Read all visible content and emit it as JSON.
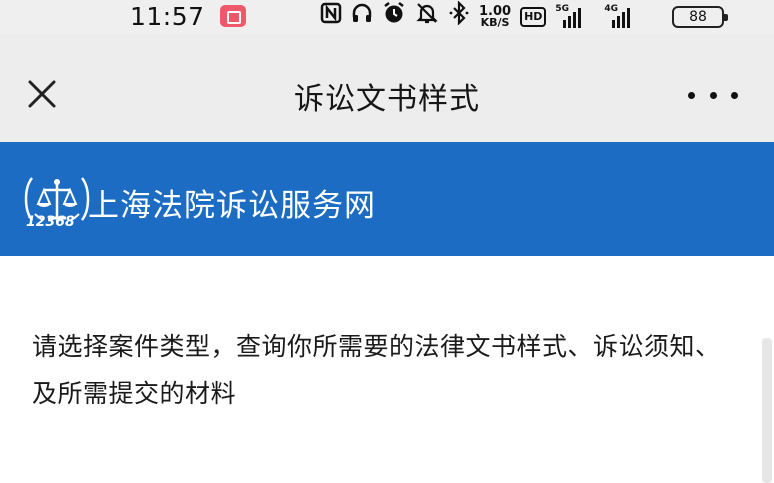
{
  "status_bar": {
    "time": "11:57",
    "net_speed": "1.00",
    "net_unit": "KB/S",
    "hd_badge": "HD",
    "signal1_label": "5G",
    "signal2_label": "4G",
    "battery": "88",
    "icons": [
      "record-icon",
      "nfc-icon",
      "headset-icon",
      "alarm-icon",
      "mute-icon",
      "bluetooth-icon"
    ]
  },
  "titlebar": {
    "title": "诉讼文书样式"
  },
  "banner": {
    "logo_number": "12368",
    "site_name": "上海法院诉讼服务网",
    "color": "#1b6cc2"
  },
  "content": {
    "intro": "请选择案件类型，查询你所需要的法律文书样式、诉讼须知、及所需提交的材料"
  }
}
